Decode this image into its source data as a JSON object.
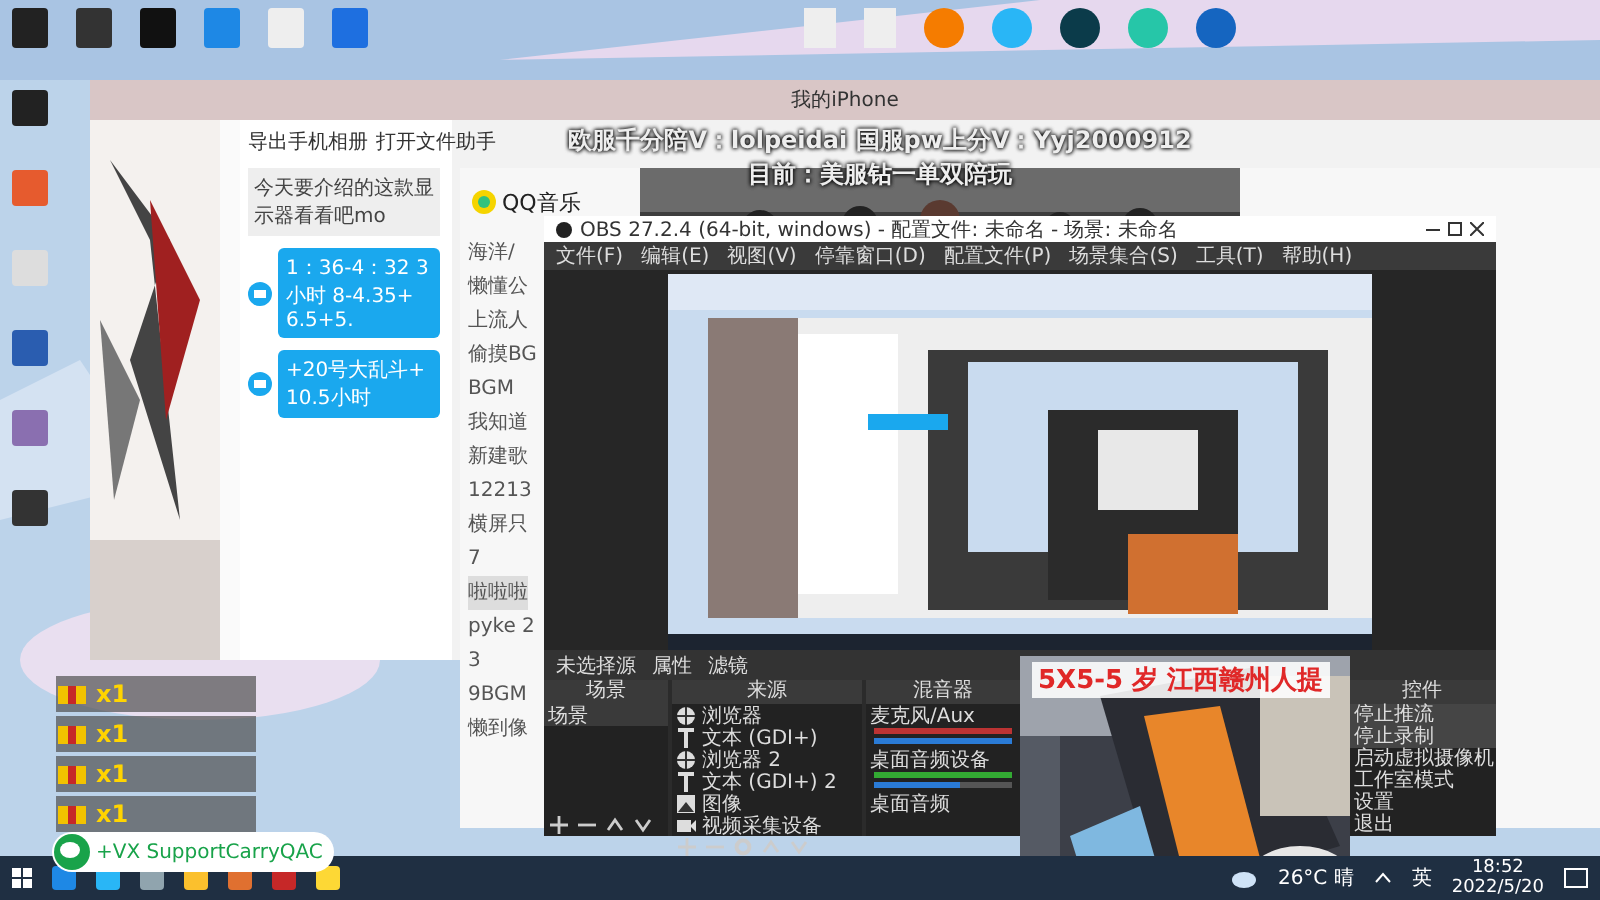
{
  "overlay_text": [
    "欧服千分陪V：lolpeidai 国服pw上分V：Yyj2000912",
    "目前：美服钻一单双陪玩"
  ],
  "phone_window": {
    "title": "我的iPhone",
    "toolbar": [
      "导出手机相册",
      "打开文件助手"
    ],
    "messages": [
      "今天要介绍的这款显示器看看吧mo"
    ],
    "bubbles": [
      "1：36-4：32 3小时 8-4.35+6.5+5.",
      "+20号大乱斗+10.5小时"
    ]
  },
  "qq_music": {
    "logo": "QQ音乐",
    "playlists": [
      {
        "label": "海洋/",
        "selected": false
      },
      {
        "label": "懒懂公",
        "selected": false
      },
      {
        "label": "上流人",
        "selected": false
      },
      {
        "label": "偷摸BG",
        "selected": false
      },
      {
        "label": "BGM",
        "selected": false
      },
      {
        "label": "我知道",
        "selected": false
      },
      {
        "label": "新建歌",
        "selected": false
      },
      {
        "label": "12213",
        "selected": false
      },
      {
        "label": "横屏只",
        "selected": false
      },
      {
        "label": "7",
        "selected": false
      },
      {
        "label": "啦啦啦",
        "selected": true
      },
      {
        "label": "pyke 2",
        "selected": false
      },
      {
        "label": "3",
        "selected": false
      },
      {
        "label": "9BGM",
        "selected": false
      },
      {
        "label": "懒到像",
        "selected": false
      }
    ]
  },
  "obs": {
    "title": "OBS 27.2.4 (64-bit, windows) - 配置文件: 未命名 - 场景: 未命名",
    "menu": [
      "文件(F)",
      "编辑(E)",
      "视图(V)",
      "停靠窗口(D)",
      "配置文件(P)",
      "场景集合(S)",
      "工具(T)",
      "帮助(H)"
    ],
    "source_bar": {
      "label": "未选择源",
      "buttons": [
        "属性",
        "滤镜"
      ]
    },
    "scenes": {
      "title": "场景",
      "items": [
        "场景"
      ]
    },
    "sources": {
      "title": "来源",
      "items": [
        {
          "name": "浏览器",
          "kind": "browser"
        },
        {
          "name": "文本 (GDI+)",
          "kind": "text"
        },
        {
          "name": "浏览器 2",
          "kind": "browser"
        },
        {
          "name": "文本 (GDI+) 2",
          "kind": "text"
        },
        {
          "name": "图像"
        },
        {
          "name": "视频采集设备",
          "kind": "camera"
        }
      ]
    },
    "mixer": {
      "title": "混音器",
      "channels": [
        {
          "name": "麦克风/Aux",
          "level": 1.0
        },
        {
          "name": "桌面音频设备",
          "level": 0.62
        }
      ],
      "extra": "桌面音频"
    },
    "controls": {
      "title": "控件",
      "items": [
        {
          "label": "停止推流",
          "active": true
        },
        {
          "label": "停止录制",
          "active": true
        },
        {
          "label": "启动虚拟摄像机",
          "active": false
        },
        {
          "label": "工作室模式",
          "active": false
        },
        {
          "label": "设置",
          "active": false
        },
        {
          "label": "退出",
          "active": false
        }
      ]
    }
  },
  "camera": {
    "caption": "5X5-5 岁 江西赣州人提"
  },
  "gifts": [
    {
      "count": "x1"
    },
    {
      "count": "x1"
    },
    {
      "count": "x1"
    },
    {
      "count": "x1"
    }
  ],
  "wechat_badge": "+VX SupportCarryQAC",
  "taskbar": {
    "weather": "26°C 晴",
    "input_method": "英",
    "time": "18:52",
    "date": "2022/5/20"
  }
}
